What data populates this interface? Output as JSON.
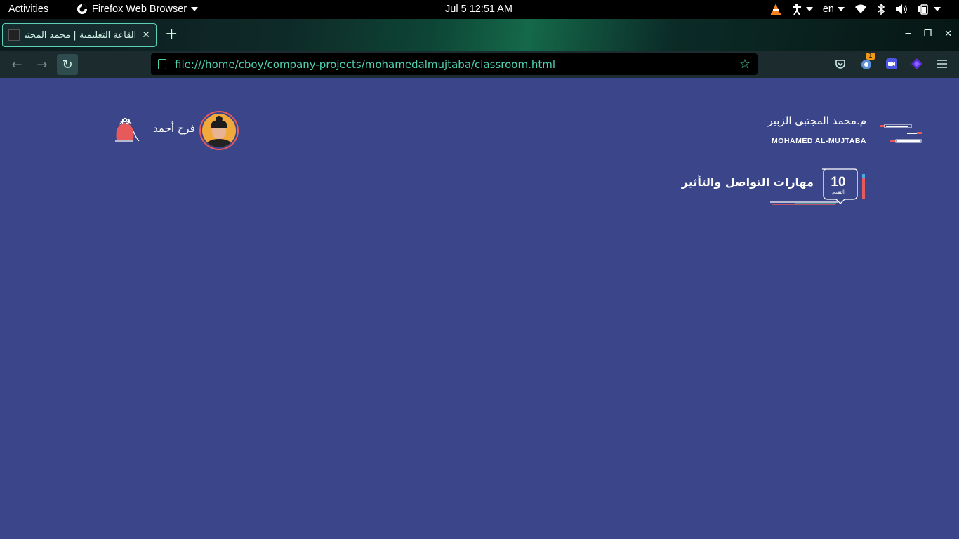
{
  "system_bar": {
    "activities": "Activities",
    "app_name": "Firefox Web Browser",
    "clock": "Jul 5  12:51 AM",
    "language": "en"
  },
  "browser": {
    "tab_title": "القاعة التعليمية | محمد المجتبى",
    "url": "file:///home/cboy/company-projects/mohamedalmujtaba/classroom.html",
    "extension_badge": "1"
  },
  "page": {
    "user": {
      "name": "فرح أحمد",
      "notifications_badge": "+9"
    },
    "brand": {
      "name_ar": "م.محمد المجتبى الزبير",
      "name_en": "MOHAMED AL-MUJTABA"
    },
    "course": {
      "title": "مهارات التواصل والتأثير",
      "progress_value": "10",
      "progress_label": "التقدم"
    }
  },
  "colors": {
    "page_background": "#3a4689",
    "accent_red": "#e8595c",
    "accent_teal": "#4fd1b0"
  }
}
